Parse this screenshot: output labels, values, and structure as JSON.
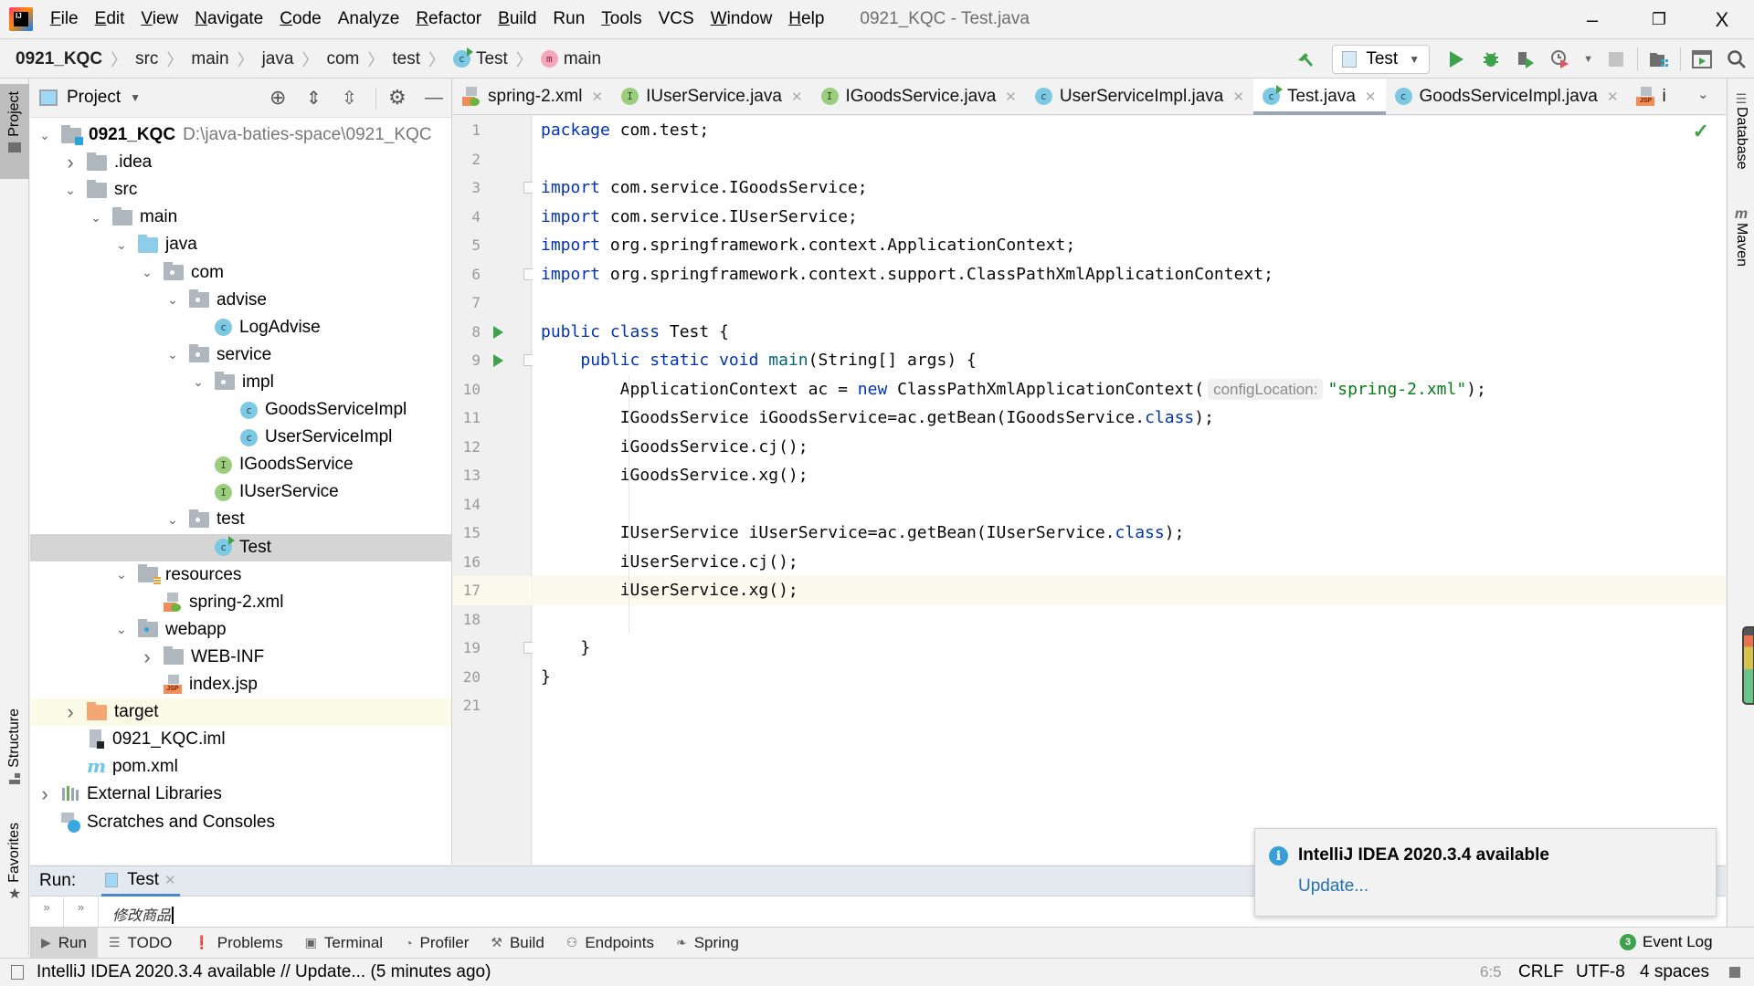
{
  "menubar": {
    "items": [
      {
        "label": "File",
        "mnemonic": "F",
        "rest": "ile"
      },
      {
        "label": "Edit",
        "mnemonic": "E",
        "rest": "dit"
      },
      {
        "label": "View",
        "mnemonic": "V",
        "rest": "iew"
      },
      {
        "label": "Navigate",
        "mnemonic": "N",
        "rest": "avigate"
      },
      {
        "label": "Code",
        "mnemonic": "C",
        "rest": "ode"
      },
      {
        "label": "Analyze",
        "mnemonic": "",
        "rest": "Analyze"
      },
      {
        "label": "Refactor",
        "mnemonic": "R",
        "rest": "efactor"
      },
      {
        "label": "Build",
        "mnemonic": "B",
        "rest": "uild"
      },
      {
        "label": "Run",
        "mnemonic": "",
        "rest": "Run"
      },
      {
        "label": "Tools",
        "mnemonic": "T",
        "rest": "ools"
      },
      {
        "label": "VCS",
        "mnemonic": "",
        "rest": "VCS"
      },
      {
        "label": "Window",
        "mnemonic": "W",
        "rest": "indow"
      },
      {
        "label": "Help",
        "mnemonic": "H",
        "rest": "elp"
      }
    ],
    "window_title": "0921_KQC - Test.java",
    "minimize": "–",
    "restore": "❐",
    "close": "X"
  },
  "breadcrumb": {
    "items": [
      "0921_KQC",
      "src",
      "main",
      "java",
      "com",
      "test",
      "Test",
      "main"
    ]
  },
  "toolbar": {
    "run_config": "Test",
    "dropdown_arrow": "▼"
  },
  "left_stripe": {
    "project": "Project",
    "structure": "Structure",
    "favorites": "Favorites"
  },
  "right_stripe": {
    "database": "Database",
    "maven": "Maven"
  },
  "project_panel": {
    "title": "Project",
    "tree": [
      {
        "label": "0921_KQC",
        "extra": "D:\\java-baties-space\\0921_KQC",
        "depth": 0,
        "chev": "open",
        "icon": "module"
      },
      {
        "label": ".idea",
        "depth": 1,
        "chev": "closed",
        "icon": "folder"
      },
      {
        "label": "src",
        "depth": 1,
        "chev": "open",
        "icon": "folder"
      },
      {
        "label": "main",
        "depth": 2,
        "chev": "open",
        "icon": "folder"
      },
      {
        "label": "java",
        "depth": 3,
        "chev": "open",
        "icon": "folder-blue"
      },
      {
        "label": "com",
        "depth": 4,
        "chev": "open",
        "icon": "package"
      },
      {
        "label": "advise",
        "depth": 5,
        "chev": "open",
        "icon": "package"
      },
      {
        "label": "LogAdvise",
        "depth": 6,
        "chev": "",
        "icon": "class"
      },
      {
        "label": "service",
        "depth": 5,
        "chev": "open",
        "icon": "package"
      },
      {
        "label": "impl",
        "depth": 6,
        "chev": "open",
        "icon": "package"
      },
      {
        "label": "GoodsServiceImpl",
        "depth": 7,
        "chev": "",
        "icon": "class"
      },
      {
        "label": "UserServiceImpl",
        "depth": 7,
        "chev": "",
        "icon": "class"
      },
      {
        "label": "IGoodsService",
        "depth": 6,
        "chev": "",
        "icon": "interface"
      },
      {
        "label": "IUserService",
        "depth": 6,
        "chev": "",
        "icon": "interface"
      },
      {
        "label": "test",
        "depth": 5,
        "chev": "open",
        "icon": "package"
      },
      {
        "label": "Test",
        "depth": 6,
        "chev": "",
        "icon": "class-run",
        "selected": true
      },
      {
        "label": "resources",
        "depth": 3,
        "chev": "open",
        "icon": "resources"
      },
      {
        "label": "spring-2.xml",
        "depth": 4,
        "chev": "",
        "icon": "xml"
      },
      {
        "label": "webapp",
        "depth": 3,
        "chev": "open",
        "icon": "web"
      },
      {
        "label": "WEB-INF",
        "depth": 4,
        "chev": "closed",
        "icon": "folder"
      },
      {
        "label": "index.jsp",
        "depth": 4,
        "chev": "",
        "icon": "jsp"
      },
      {
        "label": "target",
        "depth": 1,
        "chev": "closed",
        "icon": "folder-orange",
        "highlight": true
      },
      {
        "label": "0921_KQC.iml",
        "depth": 1,
        "chev": "",
        "icon": "iml"
      },
      {
        "label": "pom.xml",
        "depth": 1,
        "chev": "",
        "icon": "maven"
      },
      {
        "label": "External Libraries",
        "depth": 0,
        "chev": "closed",
        "icon": "libraries"
      },
      {
        "label": "Scratches and Consoles",
        "depth": 0,
        "chev": "",
        "icon": "scratches"
      }
    ]
  },
  "editor_tabs": [
    {
      "label": "spring-2.xml",
      "icon": "xml",
      "active": false
    },
    {
      "label": "IUserService.java",
      "icon": "interface",
      "active": false
    },
    {
      "label": "IGoodsService.java",
      "icon": "interface",
      "active": false
    },
    {
      "label": "UserServiceImpl.java",
      "icon": "class",
      "active": false
    },
    {
      "label": "Test.java",
      "icon": "class-run",
      "active": true
    },
    {
      "label": "GoodsServiceImpl.java",
      "icon": "class",
      "active": false
    },
    {
      "label": "i",
      "icon": "jsp",
      "active": false
    }
  ],
  "editor": {
    "current_line": 17,
    "run_gutter_lines": [
      8,
      9
    ],
    "fold_lines": [
      3,
      6,
      9,
      19
    ],
    "lines": [
      [
        {
          "t": "package",
          "c": "kw"
        },
        {
          "t": " com.test;"
        }
      ],
      [],
      [
        {
          "t": "import",
          "c": "kw"
        },
        {
          "t": " com.service.IGoodsService;"
        }
      ],
      [
        {
          "t": "import",
          "c": "kw"
        },
        {
          "t": " com.service.IUserService;"
        }
      ],
      [
        {
          "t": "import",
          "c": "kw"
        },
        {
          "t": " org.springframework.context.ApplicationContext;"
        }
      ],
      [
        {
          "t": "import",
          "c": "kw"
        },
        {
          "t": " org.springframework.context.support.ClassPathXmlApplicationContext;"
        }
      ],
      [],
      [
        {
          "t": "public class",
          "c": "kw"
        },
        {
          "t": " Test {"
        }
      ],
      [
        {
          "t": "    "
        },
        {
          "t": "public static void",
          "c": "kw"
        },
        {
          "t": " "
        },
        {
          "t": "main",
          "c": "mth"
        },
        {
          "t": "(String[] args) {"
        }
      ],
      [
        {
          "t": "        ApplicationContext ac = "
        },
        {
          "t": "new",
          "c": "kw"
        },
        {
          "t": " ClassPathXmlApplicationContext("
        },
        {
          "t": "configLocation:",
          "c": "hint"
        },
        {
          "t": "\"spring-2.xml\"",
          "c": "str"
        },
        {
          "t": ");"
        }
      ],
      [
        {
          "t": "        IGoodsService iGoodsService=ac.getBean(IGoodsService."
        },
        {
          "t": "class",
          "c": "kw"
        },
        {
          "t": ");"
        }
      ],
      [
        {
          "t": "        iGoodsService.cj();"
        }
      ],
      [
        {
          "t": "        iGoodsService.xg();"
        }
      ],
      [],
      [
        {
          "t": "        IUserService iUserService=ac.getBean(IUserService."
        },
        {
          "t": "class",
          "c": "kw"
        },
        {
          "t": ");"
        }
      ],
      [
        {
          "t": "        iUserService.cj();"
        }
      ],
      [
        {
          "t": "        iUserService.xg();"
        }
      ],
      [],
      [
        {
          "t": "    }"
        }
      ],
      [
        {
          "t": "}"
        }
      ],
      []
    ]
  },
  "run_panel": {
    "label": "Run:",
    "tab": "Test",
    "output_line": "修改商品"
  },
  "bottom_tools": [
    "Run",
    "TODO",
    "Problems",
    "Terminal",
    "Profiler",
    "Build",
    "Endpoints",
    "Spring"
  ],
  "event_log": {
    "label": "Event Log",
    "count": "3"
  },
  "notification": {
    "title": "IntelliJ IDEA 2020.3.4 available",
    "link": "Update..."
  },
  "statusbar": {
    "message": "IntelliJ IDEA 2020.3.4 available // Update... (5 minutes ago)",
    "line_ending": "CRLF",
    "encoding": "UTF-8",
    "indent": "4 spaces",
    "position": "6:5"
  },
  "colors": {
    "keyword": "#0033b3",
    "string": "#067d17",
    "run_green": "#3ea24b",
    "link_blue": "#2470b3"
  }
}
